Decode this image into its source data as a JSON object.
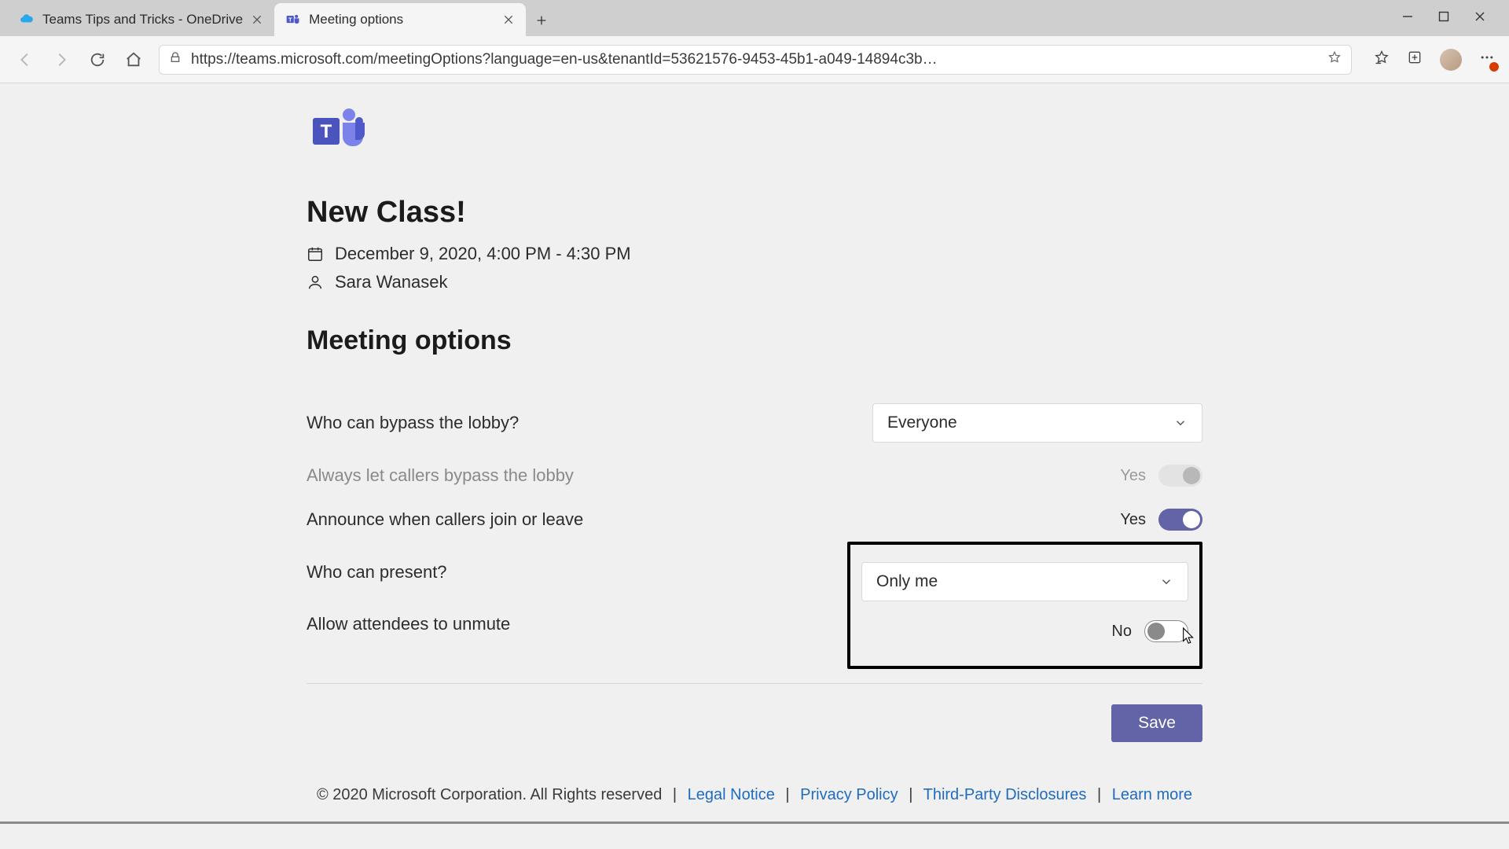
{
  "browser": {
    "tabs": [
      {
        "title": "Teams Tips and Tricks - OneDrive",
        "active": false
      },
      {
        "title": "Meeting options",
        "active": true
      }
    ],
    "url": "https://teams.microsoft.com/meetingOptions?language=en-us&tenantId=53621576-9453-45b1-a049-14894c3b…"
  },
  "meeting": {
    "title": "New Class!",
    "datetime": "December 9, 2020, 4:00 PM - 4:30 PM",
    "organizer": "Sara Wanasek"
  },
  "section_title": "Meeting options",
  "options": {
    "bypass_lobby": {
      "label": "Who can bypass the lobby?",
      "value": "Everyone"
    },
    "callers_bypass": {
      "label": "Always let callers bypass the lobby",
      "value_label": "Yes",
      "state": "disabled-on"
    },
    "announce": {
      "label": "Announce when callers join or leave",
      "value_label": "Yes",
      "state": "on"
    },
    "present": {
      "label": "Who can present?",
      "value": "Only me"
    },
    "unmute": {
      "label": "Allow attendees to unmute",
      "value_label": "No",
      "state": "off"
    }
  },
  "save_label": "Save",
  "footer": {
    "copyright": "© 2020 Microsoft Corporation. All Rights reserved",
    "links": {
      "legal": "Legal Notice",
      "privacy": "Privacy Policy",
      "third": "Third-Party Disclosures",
      "learn": "Learn more"
    }
  }
}
